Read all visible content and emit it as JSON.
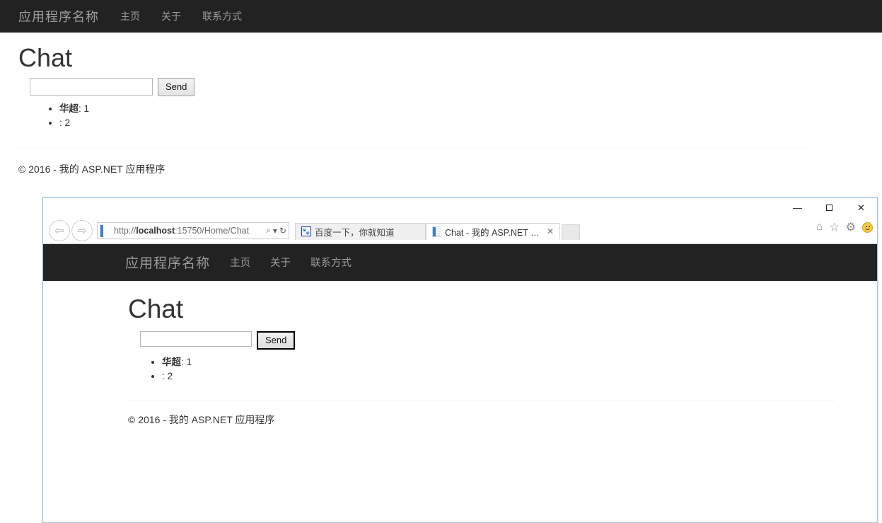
{
  "outer_page": {
    "navbar": {
      "brand": "应用程序名称",
      "links": [
        {
          "label": "主页"
        },
        {
          "label": "关于"
        },
        {
          "label": "联系方式"
        }
      ]
    },
    "heading": "Chat",
    "chat_form": {
      "input_value": "",
      "input_placeholder": "",
      "send_label": "Send"
    },
    "messages": [
      {
        "user": "华超",
        "separator": ": ",
        "text": "1"
      },
      {
        "user": "",
        "separator": ": ",
        "text": "2"
      }
    ],
    "footer": "© 2016 - 我的 ASP.NET 应用程序"
  },
  "browser_window": {
    "window_controls": {
      "minimize": "—",
      "maximize": "□",
      "close": "✕"
    },
    "navigation": {
      "back_icon": "back-arrow-icon",
      "forward_icon": "forward-arrow-icon",
      "back_glyph": "⇦",
      "forward_glyph": "⇨"
    },
    "address_bar": {
      "url_scheme": "http://",
      "url_host": "localhost",
      "url_rest": ":15750/Home/Chat",
      "url_full": "http://localhost:15750/Home/Chat",
      "favicon": "page-icon",
      "search_glyph": "⌕",
      "caret_glyph": "▾",
      "refresh_glyph": "↻"
    },
    "tabs": [
      {
        "title": "百度一下，你就知道",
        "favicon": "baidu-paw-icon",
        "active": false,
        "closable": false
      },
      {
        "title": "Chat - 我的 ASP.NET 应用...",
        "favicon": "page-icon",
        "active": true,
        "closable": true,
        "close_glyph": "✕"
      }
    ],
    "new_tab_label": "",
    "command_bar": {
      "home_glyph": "⌂",
      "favorites_glyph": "☆",
      "tools_glyph": "⚙",
      "smiley": "smiley-face-icon"
    },
    "page": {
      "navbar": {
        "brand": "应用程序名称",
        "links": [
          {
            "label": "主页"
          },
          {
            "label": "关于"
          },
          {
            "label": "联系方式"
          }
        ]
      },
      "heading": "Chat",
      "chat_form": {
        "input_value": "",
        "input_placeholder": "",
        "send_label": "Send",
        "send_focused": true
      },
      "messages": [
        {
          "user": "华超",
          "separator": ": ",
          "text": "1"
        },
        {
          "user": "",
          "separator": ": ",
          "text": "2"
        }
      ],
      "footer": "© 2016 - 我的 ASP.NET 应用程序"
    }
  },
  "colors": {
    "navbar_bg": "#222222",
    "navbar_text": "#9d9d9d",
    "window_border": "#a3c5e0",
    "accent_blue": "#3b7fd4",
    "smiley_yellow": "#f5cb3c"
  }
}
